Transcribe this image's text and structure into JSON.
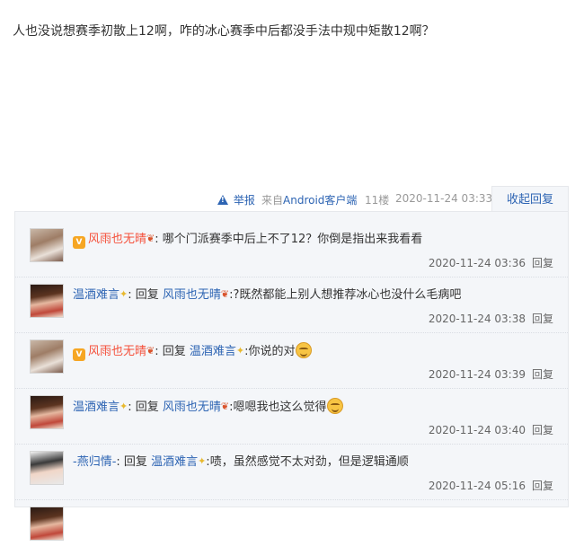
{
  "post": {
    "text": "人也没说想赛季初散上12啊，咋的冰心赛季中后都没手法中规中矩散12啊？",
    "report": "举报",
    "source_prefix": "来自",
    "source": "Android客户端",
    "floor": "11楼",
    "time": "2020-11-24 03:33",
    "collapse_reply": "收起回复"
  },
  "replies": [
    {
      "user": "风雨也无晴",
      "vip_badge": "V",
      "reply_to": "",
      "text": "哪个门派赛季中后上不了12？你倒是指出来我看看",
      "emoji": "",
      "time": "2020-11-24 03:36",
      "reply_label": "回复"
    },
    {
      "user": "温酒难言",
      "reply_prefix": "回复",
      "reply_to": "风雨也无晴",
      "text": "?既然都能上别人想推荐冰心也没什么毛病吧",
      "emoji": "",
      "time": "2020-11-24 03:38",
      "reply_label": "回复"
    },
    {
      "user": "风雨也无晴",
      "vip_badge": "V",
      "reply_prefix": "回复",
      "reply_to": "温酒难言",
      "text": "你说的对",
      "emoji": "smiley-emoji",
      "time": "2020-11-24 03:39",
      "reply_label": "回复"
    },
    {
      "user": "温酒难言",
      "reply_prefix": "回复",
      "reply_to": "风雨也无晴",
      "text": "嗯嗯我也这么觉得",
      "emoji": "smiley-emoji",
      "time": "2020-11-24 03:40",
      "reply_label": "回复"
    },
    {
      "user": "-燕归情-",
      "reply_prefix": "回复",
      "reply_to": "温酒难言",
      "text": "啧，虽然感觉不太对劲，但是逻辑通顺",
      "emoji": "",
      "time": "2020-11-24 05:16",
      "reply_label": "回复"
    }
  ],
  "colors": {
    "link_blue": "#2d64b3",
    "name_red": "#f5503b",
    "panel_bg": "#f4f6f9"
  }
}
